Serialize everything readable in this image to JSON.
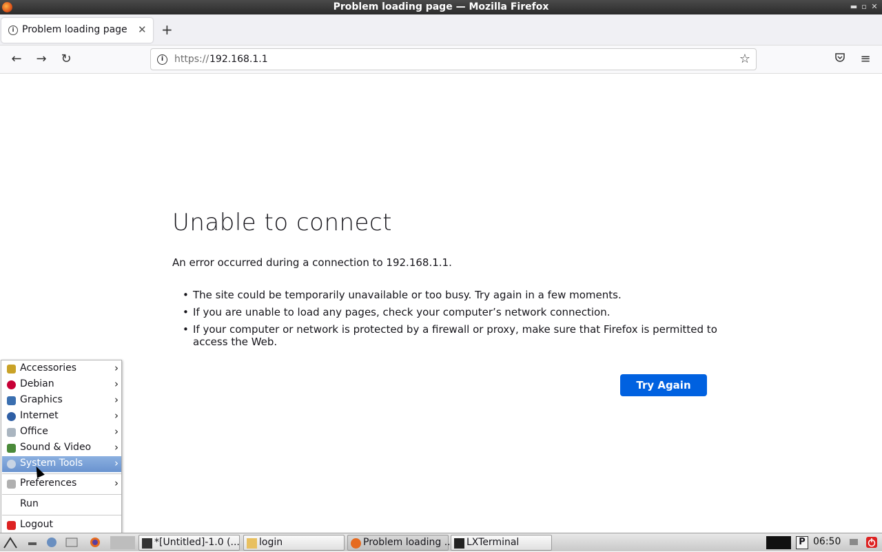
{
  "window": {
    "title": "Problem loading page — Mozilla Firefox"
  },
  "tabs": [
    {
      "label": "Problem loading page"
    }
  ],
  "url": {
    "scheme": "https://",
    "host": "192.168.1.1"
  },
  "error": {
    "title": "Unable to connect",
    "message": "An error occurred during a connection to 192.168.1.1.",
    "bullets": [
      "The site could be temporarily unavailable or too busy. Try again in a few moments.",
      "If you are unable to load any pages, check your computer’s network connection.",
      "If your computer or network is protected by a firewall or proxy, make sure that Firefox is permitted to access the Web."
    ],
    "button": "Try Again"
  },
  "menu": {
    "items": [
      {
        "label": "Accessories",
        "icon": "accessories-icon",
        "color": "#c9a227"
      },
      {
        "label": "Debian",
        "icon": "debian-icon",
        "color": "#c70036"
      },
      {
        "label": "Graphics",
        "icon": "graphics-icon",
        "color": "#3a6fb0"
      },
      {
        "label": "Internet",
        "icon": "internet-icon",
        "color": "#2f5fa5"
      },
      {
        "label": "Office",
        "icon": "office-icon",
        "color": "#9ab"
      },
      {
        "label": "Sound & Video",
        "icon": "sound-video-icon",
        "color": "#4a8a3a"
      },
      {
        "label": "System Tools",
        "icon": "system-tools-icon",
        "color": "#8fa8c8"
      }
    ],
    "preferences": "Preferences",
    "run": "Run",
    "logout": "Logout"
  },
  "taskbar": {
    "tasks": [
      {
        "label": "*[Untitled]-1.0 (..."
      },
      {
        "label": "login"
      },
      {
        "label": "Problem loading ..."
      },
      {
        "label": "LXTerminal"
      }
    ],
    "clock": "06:50"
  },
  "colors": {
    "accent": "#0061e0",
    "menu_highlight": "#7aa0d8"
  }
}
